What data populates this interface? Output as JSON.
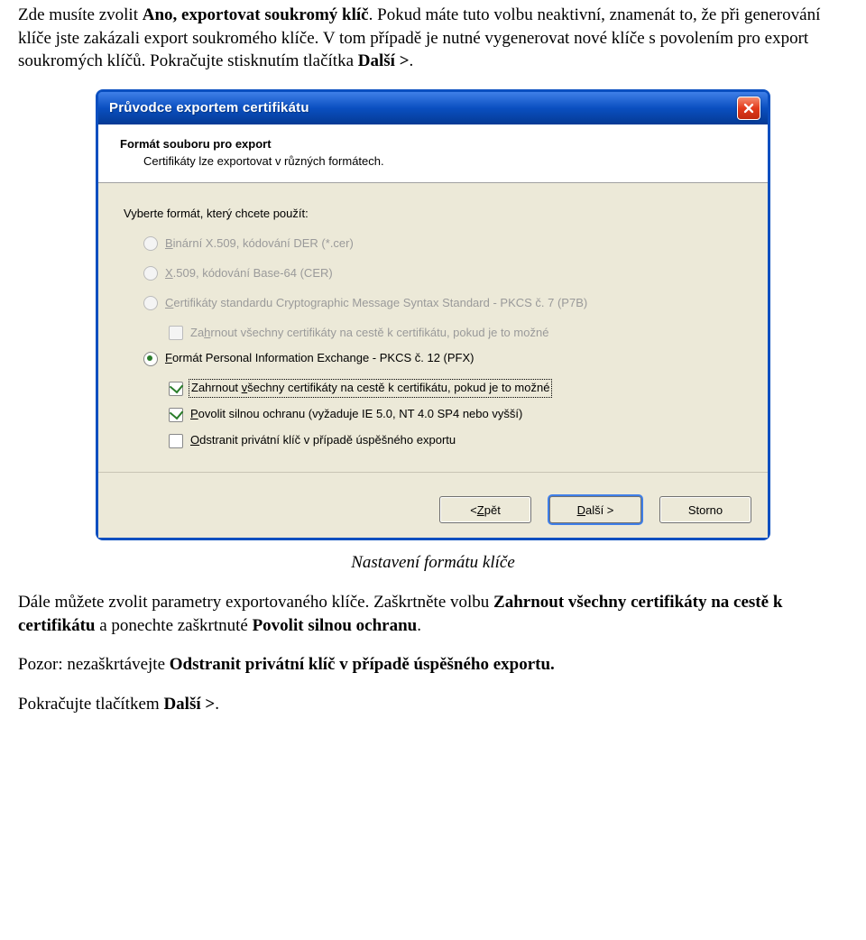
{
  "doc": {
    "p1_a": "Zde musíte zvolit ",
    "p1_b": "Ano, exportovat soukromý klíč",
    "p1_c": ". Pokud máte tuto volbu neaktivní, znamenát to, že při generování klíče jste zakázali export soukromého klíče. V tom případě je nutné vygenerovat nové klíče s povolením pro export soukromých klíčů. Pokračujte stisknutím tlačítka ",
    "p1_d": "Další >",
    "p1_e": ".",
    "caption": "Nastavení formátu klíče",
    "p2_a": "Dále můžete zvolit parametry exportovaného klíče. Zaškrtněte volbu ",
    "p2_b": "Zahrnout všechny certifikáty na cestě k certifikátu",
    "p2_c": " a ponechte zaškrtnuté ",
    "p2_d": "Povolit silnou ochranu",
    "p2_e": ".",
    "p3_a": "Pozor: nezaškrtávejte ",
    "p3_b": "Odstranit privátní klíč v případě úspěšného exportu.",
    "p4_a": "Pokračujte tlačítkem ",
    "p4_b": "Další >",
    "p4_c": "."
  },
  "wizard": {
    "title": "Průvodce exportem certifikátu",
    "header_title": "Formát souboru pro export",
    "header_sub": "Certifikáty lze exportovat v různých formátech.",
    "lead": "Vyberte formát, který chcete použít:",
    "opt1_pre": "B",
    "opt1_rest": "inární X.509, kódování DER (*.cer)",
    "opt2_pre": "X",
    "opt2_rest": ".509, kódování Base-64 (CER)",
    "opt3_pre": "C",
    "opt3_rest": "ertifikáty standardu Cryptographic Message Syntax Standard - PKCS č. 7 (P7B)",
    "opt3_sub_a": "Za",
    "opt3_sub_u": "h",
    "opt3_sub_b": "rnout všechny certifikáty na cestě k certifikátu, pokud je to možné",
    "opt4_pre": "F",
    "opt4_rest": "ormát Personal Information Exchange - PKCS č. 12 (PFX)",
    "opt4_sub1_a": "Zahrnout ",
    "opt4_sub1_u": "v",
    "opt4_sub1_b": "šechny certifikáty na cestě k certifikátu, pokud je to možné",
    "opt4_sub2_u": "P",
    "opt4_sub2_b": "ovolit silnou ochranu (vyžaduje IE 5.0, NT 4.0 SP4 nebo vyšší)",
    "opt4_sub3_u": "O",
    "opt4_sub3_b": "dstranit privátní klíč v případě úspěšného exportu",
    "btn_back_a": "< ",
    "btn_back_u": "Z",
    "btn_back_b": "pět",
    "btn_next_u": "D",
    "btn_next_b": "alší >",
    "btn_cancel": "Storno"
  }
}
